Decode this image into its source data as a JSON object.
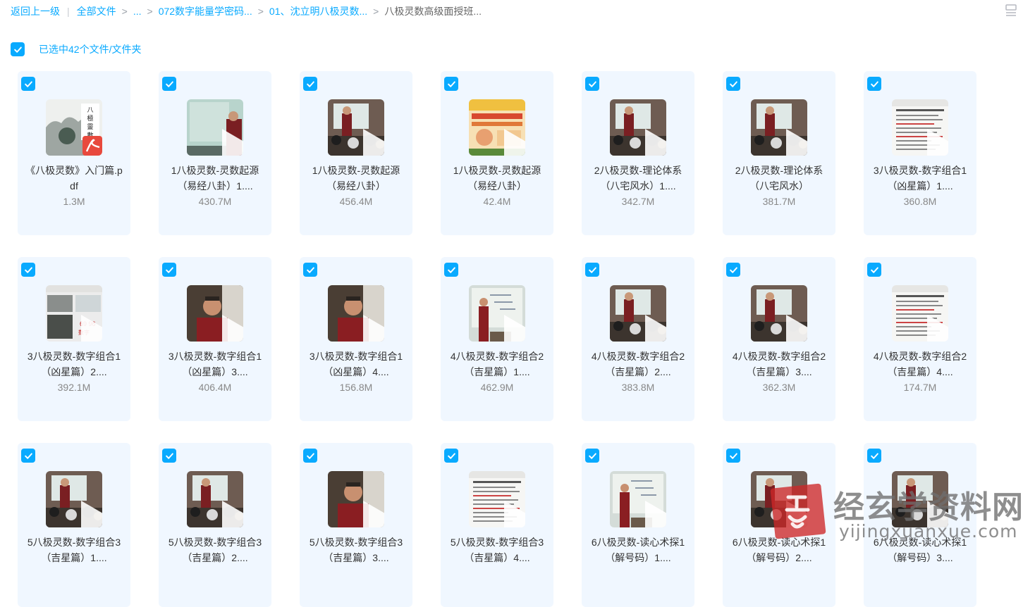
{
  "breadcrumb": {
    "back": "返回上一级",
    "all_files": "全部文件",
    "ellipsis": "...",
    "items": [
      "072数字能量学密码...",
      "01、沈立明八极灵数..."
    ],
    "current": "八极灵数高级面授班..."
  },
  "selection": {
    "label": "已选中42个文件/文件夹"
  },
  "files": [
    {
      "name": "《八极灵数》入门篇.pdf",
      "size": "1.3M",
      "kind": "pdf",
      "thumb": "pdf"
    },
    {
      "name": "1八极灵数-灵数起源（易经八卦）1....",
      "size": "430.7M",
      "kind": "video",
      "thumb": "board"
    },
    {
      "name": "1八极灵数-灵数起源（易经八卦）",
      "size": "456.4M",
      "kind": "video",
      "thumb": "class"
    },
    {
      "name": "1八极灵数-灵数起源（易经八卦）",
      "size": "42.4M",
      "kind": "video",
      "thumb": "poster"
    },
    {
      "name": "2八极灵数-理论体系（八宅风水）1....",
      "size": "342.7M",
      "kind": "video",
      "thumb": "class"
    },
    {
      "name": "2八极灵数-理论体系（八宅风水）",
      "size": "381.7M",
      "kind": "video",
      "thumb": "class"
    },
    {
      "name": "3八极灵数-数字组合1（凶星篇）1....",
      "size": "360.8M",
      "kind": "video",
      "thumb": "doc"
    },
    {
      "name": "3八极灵数-数字组合1（凶星篇）2....",
      "size": "392.1M",
      "kind": "video",
      "thumb": "collage"
    },
    {
      "name": "3八极灵数-数字组合1（凶星篇）3....",
      "size": "406.4M",
      "kind": "video",
      "thumb": "speaker"
    },
    {
      "name": "3八极灵数-数字组合1（凶星篇）4....",
      "size": "156.8M",
      "kind": "video",
      "thumb": "speaker"
    },
    {
      "name": "4八极灵数-数字组合2（吉星篇）1....",
      "size": "462.9M",
      "kind": "video",
      "thumb": "whiteboard"
    },
    {
      "name": "4八极灵数-数字组合2（吉星篇）2....",
      "size": "383.8M",
      "kind": "video",
      "thumb": "class"
    },
    {
      "name": "4八极灵数-数字组合2（吉星篇）3....",
      "size": "362.3M",
      "kind": "video",
      "thumb": "class"
    },
    {
      "name": "4八极灵数-数字组合2（吉星篇）4....",
      "size": "174.7M",
      "kind": "video",
      "thumb": "doc"
    },
    {
      "name": "5八极灵数-数字组合3（吉星篇）1....",
      "size": "",
      "kind": "video",
      "thumb": "class"
    },
    {
      "name": "5八极灵数-数字组合3（吉星篇）2....",
      "size": "",
      "kind": "video",
      "thumb": "class"
    },
    {
      "name": "5八极灵数-数字组合3（吉星篇）3....",
      "size": "",
      "kind": "video",
      "thumb": "speaker"
    },
    {
      "name": "5八极灵数-数字组合3（吉星篇）4....",
      "size": "",
      "kind": "video",
      "thumb": "doc"
    },
    {
      "name": "6八极灵数-读心术探1（解号码）1....",
      "size": "",
      "kind": "video",
      "thumb": "whiteboard"
    },
    {
      "name": "6八极灵数-读心术探1（解号码）2....",
      "size": "",
      "kind": "video",
      "thumb": "class"
    },
    {
      "name": "6八极灵数-读心术探1（解号码）3....",
      "size": "",
      "kind": "video",
      "thumb": "class"
    }
  ],
  "watermark": {
    "title": "经玄学资料网",
    "url": "yijingxuanxue.com"
  },
  "colors": {
    "accent": "#09aaff",
    "tile_bg": "#f0f7ff",
    "size_text": "#888888"
  }
}
